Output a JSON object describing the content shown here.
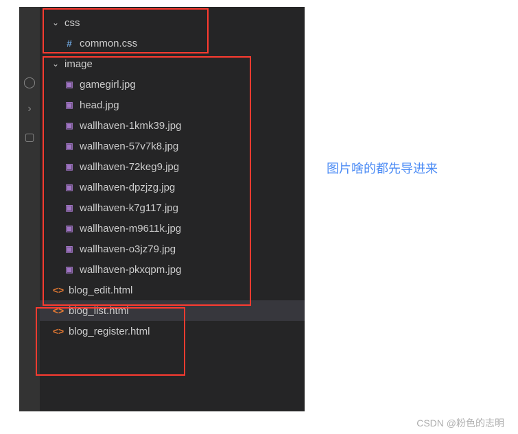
{
  "folders": {
    "css": {
      "name": "css",
      "files": [
        "common.css"
      ]
    },
    "image": {
      "name": "image",
      "files": [
        "gamegirl.jpg",
        "head.jpg",
        "wallhaven-1kmk39.jpg",
        "wallhaven-57v7k8.jpg",
        "wallhaven-72keg9.jpg",
        "wallhaven-dpzjzg.jpg",
        "wallhaven-k7g117.jpg",
        "wallhaven-m9611k.jpg",
        "wallhaven-o3jz79.jpg",
        "wallhaven-pkxqpm.jpg"
      ]
    }
  },
  "root_files": [
    "blog_edit.html",
    "blog_list.html",
    "blog_register.html"
  ],
  "selected_file": "blog_list.html",
  "annotation": "图片啥的都先导进来",
  "watermark": "CSDN @粉色的志明"
}
